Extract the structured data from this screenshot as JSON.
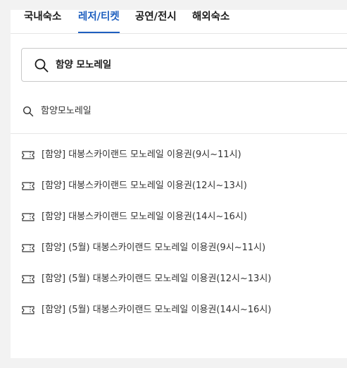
{
  "tabs": [
    {
      "label": "국내숙소",
      "active": false
    },
    {
      "label": "레저/티켓",
      "active": true
    },
    {
      "label": "공연/전시",
      "active": false
    },
    {
      "label": "해외숙소",
      "active": false
    }
  ],
  "search": {
    "value": "함양 모노레일",
    "icon": "search-icon"
  },
  "suggestion": {
    "label": "함양모노레일",
    "icon": "search-icon"
  },
  "results": [
    {
      "label": "[함양] 대봉스카이랜드 모노레일 이용권(9시~11시)",
      "icon": "ticket-icon"
    },
    {
      "label": "[함양] 대봉스카이랜드 모노레일 이용권(12시~13시)",
      "icon": "ticket-icon"
    },
    {
      "label": "[함양] 대봉스카이랜드 모노레일 이용권(14시~16시)",
      "icon": "ticket-icon"
    },
    {
      "label": "[함양] (5월) 대봉스카이랜드 모노레일 이용권(9시~11시)",
      "icon": "ticket-icon"
    },
    {
      "label": "[함양] (5월) 대봉스카이랜드 모노레일 이용권(12시~13시)",
      "icon": "ticket-icon"
    },
    {
      "label": "[함양] (5월) 대봉스카이랜드 모노레일 이용권(14시~16시)",
      "icon": "ticket-icon"
    }
  ],
  "colors": {
    "accent": "#1e5fbf",
    "text": "#1a1a1a",
    "border": "#c9c9c9",
    "background": "#f2f2f2"
  }
}
